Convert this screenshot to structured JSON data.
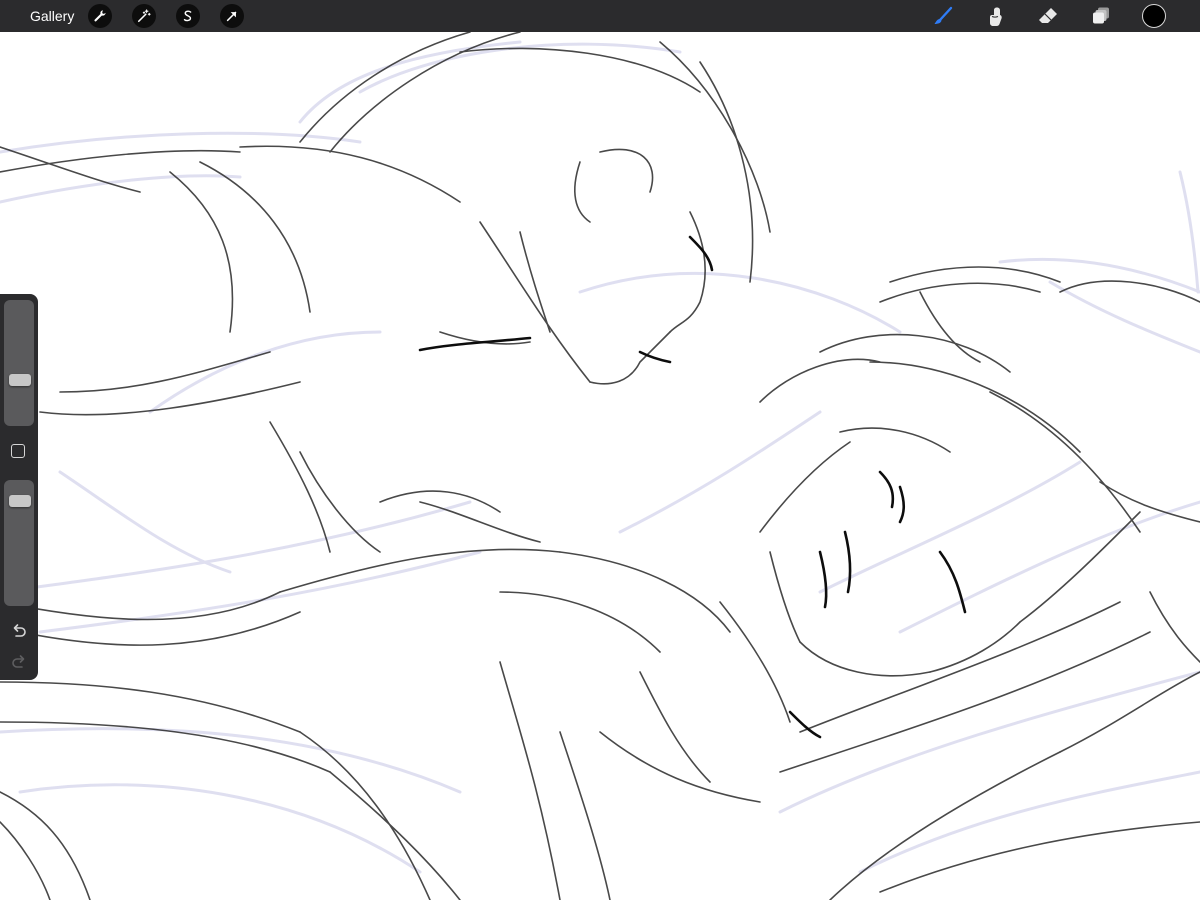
{
  "topbar": {
    "gallery_label": "Gallery",
    "left_tools": [
      {
        "icon": "wrench-icon",
        "name": "actions"
      },
      {
        "icon": "magic-wand-icon",
        "name": "adjustments"
      },
      {
        "icon": "selection-icon",
        "name": "selection"
      },
      {
        "icon": "transform-arrow-icon",
        "name": "transform"
      }
    ],
    "right_tools": [
      {
        "icon": "brush-icon",
        "name": "paint",
        "active": true,
        "color": "#2f7cf6"
      },
      {
        "icon": "smudge-icon",
        "name": "smudge"
      },
      {
        "icon": "eraser-icon",
        "name": "erase"
      },
      {
        "icon": "layers-icon",
        "name": "layers"
      }
    ],
    "current_color": "#000000"
  },
  "sidebar": {
    "brush_size_level": 0.35,
    "opacity_level": 0.88,
    "controls": [
      "modify-button",
      "undo-icon",
      "redo-icon"
    ]
  },
  "colors": {
    "toolbar_bg": "#2b2b2d",
    "canvas_bg": "#ffffff",
    "sketch_light": "#dcdcef",
    "sketch_dark": "#1a1a1a"
  }
}
